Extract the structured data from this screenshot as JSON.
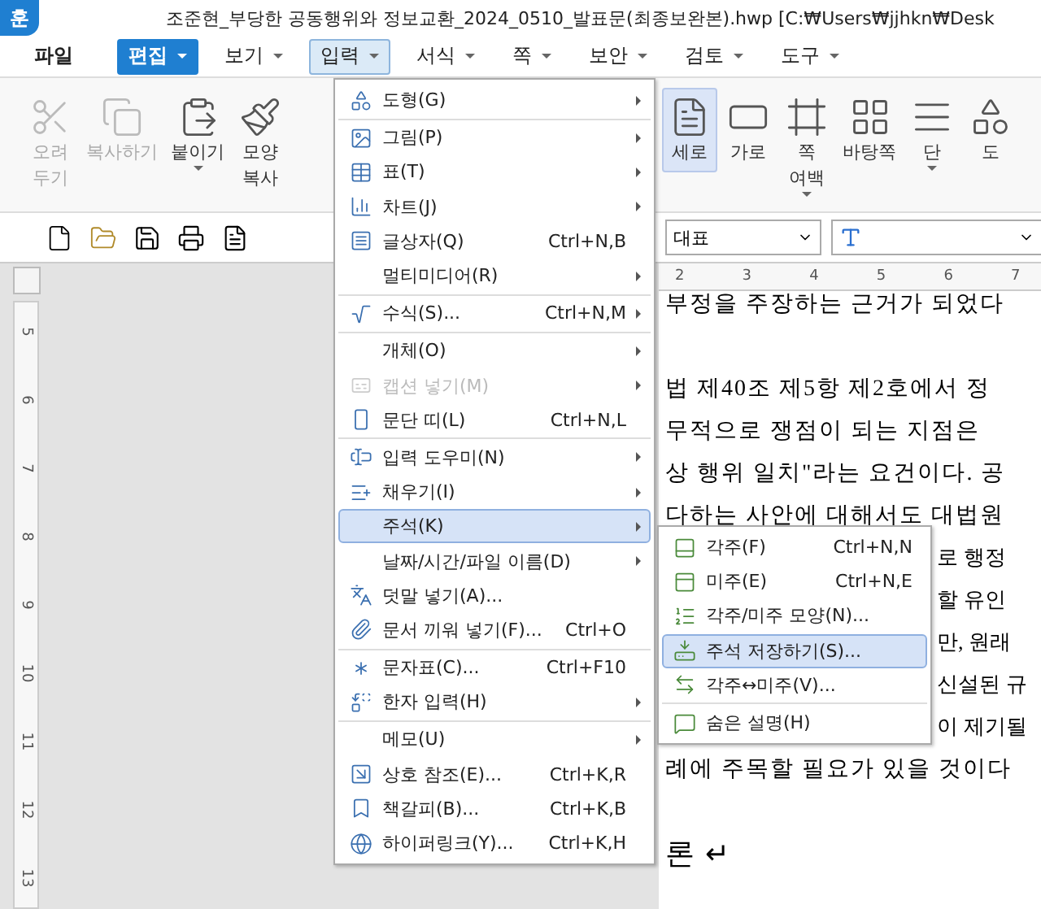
{
  "window": {
    "logo": "훈",
    "title": "조준현_부당한 공동행위와 정보교환_2024_0510_발표문(최종보완본).hwp [C:₩Users₩jjhkn₩Desk"
  },
  "menu_bar": [
    {
      "label": "파일",
      "kind": "plain",
      "caret": false,
      "selected": false
    },
    {
      "label": "편집",
      "kind": "accent",
      "caret": true,
      "selected": false
    },
    {
      "label": "보기",
      "kind": "plain",
      "caret": true,
      "selected": false
    },
    {
      "label": "입력",
      "kind": "plain",
      "caret": true,
      "selected": true
    },
    {
      "label": "서식",
      "kind": "plain",
      "caret": true,
      "selected": false
    },
    {
      "label": "쪽",
      "kind": "plain",
      "caret": true,
      "selected": false
    },
    {
      "label": "보안",
      "kind": "plain",
      "caret": true,
      "selected": false
    },
    {
      "label": "검토",
      "kind": "plain",
      "caret": true,
      "selected": false
    },
    {
      "label": "도구",
      "kind": "plain",
      "caret": true,
      "selected": false
    }
  ],
  "ribbon_left": [
    {
      "lines": [
        "오려",
        "두기"
      ],
      "disabled": true,
      "dropdown": false,
      "selected": false
    },
    {
      "lines": [
        "복사하기"
      ],
      "disabled": true,
      "dropdown": false,
      "selected": false
    },
    {
      "lines": [
        "붙이기"
      ],
      "disabled": false,
      "dropdown": true,
      "selected": false
    },
    {
      "lines": [
        "모양",
        "복사"
      ],
      "disabled": false,
      "dropdown": false,
      "selected": false
    }
  ],
  "ribbon_right": [
    {
      "lines": [
        "세로"
      ],
      "disabled": false,
      "dropdown": false,
      "selected": true
    },
    {
      "lines": [
        "가로"
      ],
      "disabled": false,
      "dropdown": false,
      "selected": false
    },
    {
      "lines": [
        "쪽",
        "여백"
      ],
      "disabled": false,
      "dropdown": true,
      "selected": false
    },
    {
      "lines": [
        "바탕쪽"
      ],
      "disabled": false,
      "dropdown": false,
      "selected": false
    },
    {
      "lines": [
        "단"
      ],
      "disabled": false,
      "dropdown": true,
      "selected": false
    },
    {
      "lines": [
        "도"
      ],
      "disabled": false,
      "dropdown": false,
      "selected": false
    }
  ],
  "toolbar": {
    "style_field": "대표"
  },
  "ruler": {
    "horizontal": [
      "2",
      "3",
      "4",
      "5",
      "6",
      "7"
    ],
    "vertical": [
      "5",
      "6",
      "7",
      "8",
      "9",
      "10",
      "11",
      "12",
      "13"
    ]
  },
  "document_lines": [
    {
      "text": "부정을 주장하는 근거가 되었다",
      "kind": "open"
    },
    {
      "kind": "blank"
    },
    {
      "text": "법 제40조 제5항 제2호에서 정",
      "kind": "open"
    },
    {
      "text": "무적으로 쟁점이 되는 지점은",
      "kind": "open"
    },
    {
      "text": "상 행위 일치\"라는 요건이다. 공",
      "kind": "open"
    },
    {
      "text": "다하는 사안에 대해서도 대법원",
      "kind": "open"
    },
    {
      "text": "로 행정",
      "kind": "behind"
    },
    {
      "text": "할 유인",
      "kind": "behind"
    },
    {
      "text": "만, 원래",
      "kind": "behind"
    },
    {
      "text": "신설된 규",
      "kind": "behind"
    },
    {
      "text": "이 제기될",
      "kind": "behind"
    },
    {
      "text": "례에 주목할 필요가 있을 것이다",
      "kind": "open"
    },
    {
      "kind": "blank"
    },
    {
      "text": "론 ↵",
      "kind": "heading"
    }
  ],
  "input_menu": [
    [
      {
        "label": "도형(G)",
        "submenu": true,
        "disabled": false,
        "selected": false,
        "icon": true
      }
    ],
    [
      {
        "label": "그림(P)",
        "submenu": true,
        "disabled": false,
        "selected": false,
        "icon": true
      },
      {
        "label": "표(T)",
        "submenu": true,
        "disabled": false,
        "selected": false,
        "icon": true
      },
      {
        "label": "차트(J)",
        "submenu": true,
        "disabled": false,
        "selected": false,
        "icon": true
      },
      {
        "label": "글상자(Q)",
        "shortcut": "Ctrl+N,B",
        "submenu": false,
        "disabled": false,
        "selected": false,
        "icon": true
      },
      {
        "label": "멀티미디어(R)",
        "submenu": true,
        "disabled": false,
        "selected": false,
        "icon": false
      }
    ],
    [
      {
        "label": "수식(S)...",
        "shortcut": "Ctrl+N,M",
        "submenu": true,
        "disabled": false,
        "selected": false,
        "icon": true
      }
    ],
    [
      {
        "label": "개체(O)",
        "submenu": true,
        "disabled": false,
        "selected": false,
        "icon": false
      },
      {
        "label": "캡션 넣기(M)",
        "submenu": true,
        "disabled": true,
        "selected": false,
        "icon": true
      },
      {
        "label": "문단 띠(L)",
        "shortcut": "Ctrl+N,L",
        "submenu": false,
        "disabled": false,
        "selected": false,
        "icon": true
      }
    ],
    [
      {
        "label": "입력 도우미(N)",
        "submenu": true,
        "disabled": false,
        "selected": false,
        "icon": true
      },
      {
        "label": "채우기(I)",
        "submenu": true,
        "disabled": false,
        "selected": false,
        "icon": true
      },
      {
        "label": "주석(K)",
        "submenu": true,
        "disabled": false,
        "selected": true,
        "icon": false
      },
      {
        "label": "날짜/시간/파일 이름(D)",
        "submenu": true,
        "disabled": false,
        "selected": false,
        "icon": false
      },
      {
        "label": "덧말 넣기(A)...",
        "submenu": false,
        "disabled": false,
        "selected": false,
        "icon": true
      },
      {
        "label": "문서 끼워 넣기(F)...",
        "shortcut": "Ctrl+O",
        "submenu": false,
        "disabled": false,
        "selected": false,
        "icon": true
      }
    ],
    [
      {
        "label": "문자표(C)...",
        "shortcut": "Ctrl+F10",
        "submenu": false,
        "disabled": false,
        "selected": false,
        "icon": true
      },
      {
        "label": "한자 입력(H)",
        "submenu": true,
        "disabled": false,
        "selected": false,
        "icon": true
      }
    ],
    [
      {
        "label": "메모(U)",
        "submenu": true,
        "disabled": false,
        "selected": false,
        "icon": false
      },
      {
        "label": "상호 참조(E)...",
        "shortcut": "Ctrl+K,R",
        "submenu": false,
        "disabled": false,
        "selected": false,
        "icon": true
      },
      {
        "label": "책갈피(B)...",
        "shortcut": "Ctrl+K,B",
        "submenu": false,
        "disabled": false,
        "selected": false,
        "icon": true
      },
      {
        "label": "하이퍼링크(Y)...",
        "shortcut": "Ctrl+K,H",
        "submenu": false,
        "disabled": false,
        "selected": false,
        "icon": true
      }
    ]
  ],
  "note_submenu": [
    [
      {
        "label": "각주(F)",
        "shortcut": "Ctrl+N,N",
        "selected": false
      },
      {
        "label": "미주(E)",
        "shortcut": "Ctrl+N,E",
        "selected": false
      },
      {
        "label": "각주/미주 모양(N)...",
        "selected": false
      },
      {
        "label": "주석 저장하기(S)...",
        "selected": true
      },
      {
        "label": "각주↔미주(V)...",
        "selected": false
      }
    ],
    [
      {
        "label": "숨은 설명(H)",
        "selected": false
      }
    ]
  ]
}
